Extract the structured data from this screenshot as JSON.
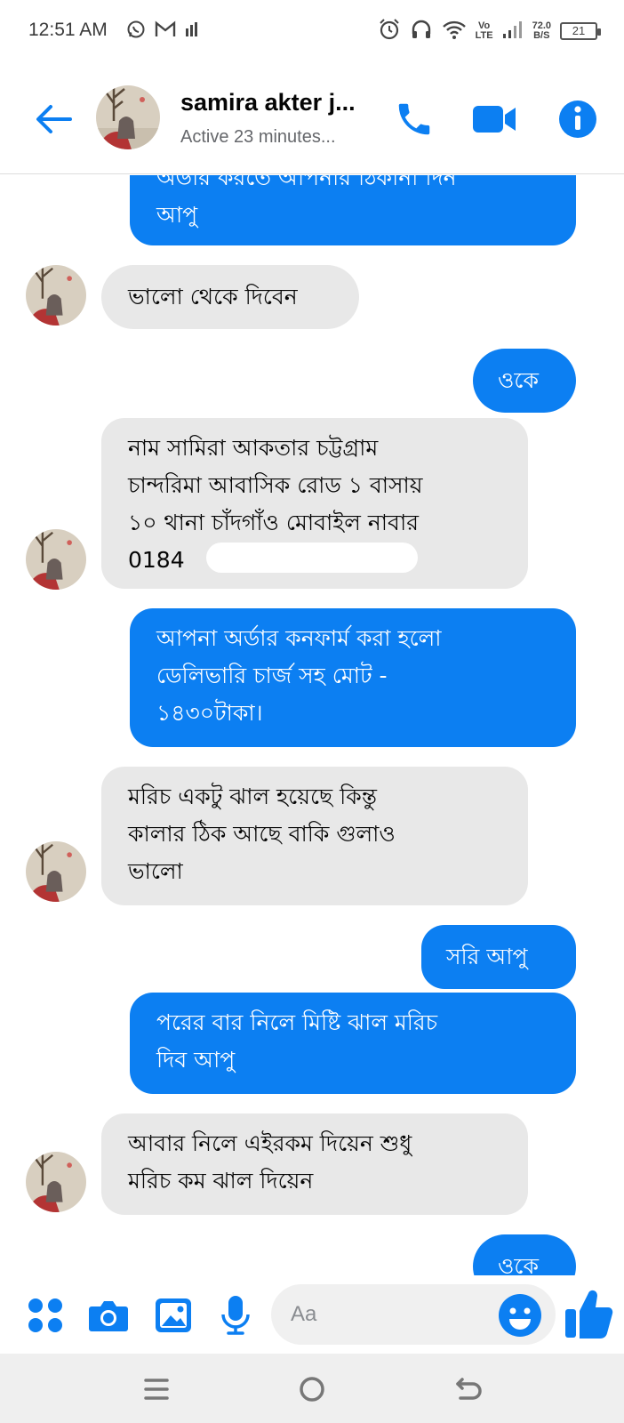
{
  "status_bar": {
    "time": "12:51 AM",
    "network_top": "Vo",
    "network_bottom": "LTE",
    "speed_value": "72.0",
    "speed_unit": "B/S",
    "battery": "21",
    "icons": [
      "whatsapp-icon",
      "gmail-icon",
      "signal-bars-icon",
      "alarm-icon",
      "headphones-icon",
      "wifi-icon",
      "cell-signal-icon",
      "battery-icon"
    ]
  },
  "header": {
    "contact_name": "samira akter j...",
    "contact_status": "Active 23 minutes...",
    "accent_color": "#0c7ff2"
  },
  "messages": [
    {
      "direction": "out",
      "lines": [
        "অডার করতে আপনার ঠিকানা দিন",
        "আপু"
      ]
    },
    {
      "direction": "in",
      "lines": [
        "ভালো থেকে দিবেন"
      ]
    },
    {
      "direction": "out",
      "lines": [
        "ওকে"
      ]
    },
    {
      "direction": "in",
      "lines": [
        "নাম সামিরা আকতার চট্টগ্রাম",
        "চান্দরিমা আবাসিক রোড ১ বাসায়",
        "১০ থানা চাঁদগাঁও মোবাইল নাবার",
        "0184"
      ]
    },
    {
      "direction": "out",
      "lines": [
        "আপনা অর্ডার কনফার্ম করা হলো",
        "ডেলিভারি চার্জ সহ মোট -",
        "১৪৩০টাকা।"
      ]
    },
    {
      "direction": "in",
      "lines": [
        "মরিচ একটু ঝাল হয়েছে কিন্তু",
        "কালার ঠিক আছে বাকি গুলাও",
        "ভালো"
      ]
    },
    {
      "direction": "out",
      "lines": [
        "সরি আপু"
      ]
    },
    {
      "direction": "out",
      "lines": [
        "পরের বার নিলে মিষ্টি ঝাল মরিচ",
        "দিব আপু"
      ]
    },
    {
      "direction": "in",
      "lines": [
        "আবার নিলে এইরকম দিয়েন শুধু",
        "মরিচ কম ঝাল দিয়েন"
      ]
    },
    {
      "direction": "out",
      "lines": [
        "ওকে"
      ]
    }
  ],
  "composer": {
    "placeholder": "Aa"
  },
  "colors": {
    "outgoing_bubble": "#0c7ff2",
    "incoming_bubble": "#e8e8e8",
    "icon_blue": "#0c7ff2"
  }
}
